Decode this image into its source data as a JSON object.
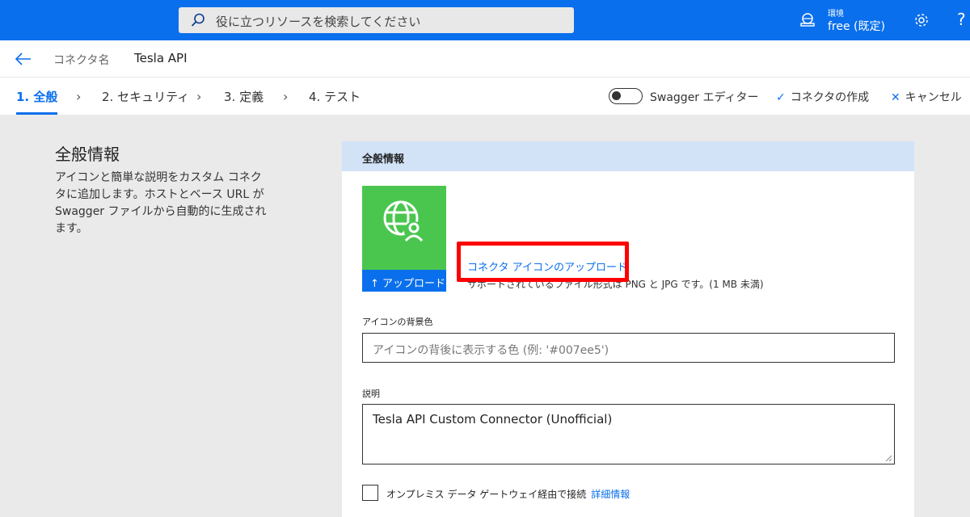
{
  "topbar": {
    "search_placeholder": "役に立つリソースを検索してください",
    "env_label": "環境",
    "env_value": "free (既定)",
    "help_label": "?"
  },
  "breadcrumb": {
    "label": "コネクタ名",
    "title": "Tesla API"
  },
  "steps": [
    {
      "label": "1. 全般"
    },
    {
      "label": "2. セキュリティ"
    },
    {
      "label": "3. 定義"
    },
    {
      "label": "4. テスト"
    }
  ],
  "toolbar": {
    "swagger_label": "Swagger エディター",
    "create_label": "コネクタの作成",
    "cancel_label": "キャンセル"
  },
  "left": {
    "title": "全般情報",
    "description": "アイコンと簡単な説明をカスタム コネクタに追加します。ホストとベース URL が Swagger ファイルから自動的に生成されます。"
  },
  "panel": {
    "header": "全般情報",
    "upload_button": "↑ アップロード",
    "upload_link": "コネクタ アイコンのアップロード",
    "upload_note": "サポートされているファイル形式は PNG と JPG です。(1 MB 未満)",
    "bg_color_label": "アイコンの背景色",
    "bg_color_placeholder": "アイコンの背後に表示する色 (例: '#007ee5')",
    "description_label": "説明",
    "description_value": "Tesla API Custom Connector (Unofficial)",
    "onprem_label": "オンプレミス データ ゲートウェイ経由で接続",
    "onprem_link": "詳細情報"
  },
  "colors": {
    "accent": "#0a6fec",
    "icon_tile": "#4ac64f",
    "panel_header": "#d2e3f8",
    "highlight": "#ff0000"
  }
}
